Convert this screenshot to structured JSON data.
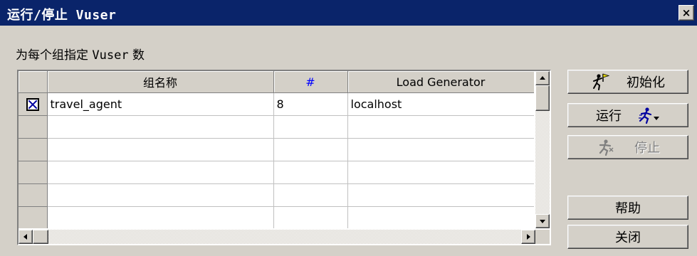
{
  "window": {
    "title": "运行/停止 Vuser",
    "close_glyph": "×"
  },
  "subtitle": {
    "prefix": "为每个组指定 ",
    "mono": "Vuser",
    "suffix": " 数"
  },
  "grid": {
    "columns": [
      "组名称",
      "#",
      "Load Generator"
    ],
    "rows": [
      {
        "checked": true,
        "group": "travel_agent",
        "count": "8",
        "generator": "localhost"
      },
      {
        "checked": false,
        "group": "",
        "count": "",
        "generator": ""
      },
      {
        "checked": false,
        "group": "",
        "count": "",
        "generator": ""
      },
      {
        "checked": false,
        "group": "",
        "count": "",
        "generator": ""
      },
      {
        "checked": false,
        "group": "",
        "count": "",
        "generator": ""
      },
      {
        "checked": false,
        "group": "",
        "count": "",
        "generator": ""
      }
    ]
  },
  "buttons": {
    "initialize": "初始化",
    "run": "运行",
    "stop": "停止",
    "help": "帮助",
    "close": "关闭"
  },
  "icons": {
    "initialize": "runner-flag-icon",
    "run": "runner-dropdown-icon",
    "stop": "runner-stop-icon",
    "checkbox": "checkbox-checked-icon"
  },
  "colors": {
    "titlebar": "#0a246a",
    "dialog": "#d4d0c8",
    "hash_header": "#0000ff"
  }
}
